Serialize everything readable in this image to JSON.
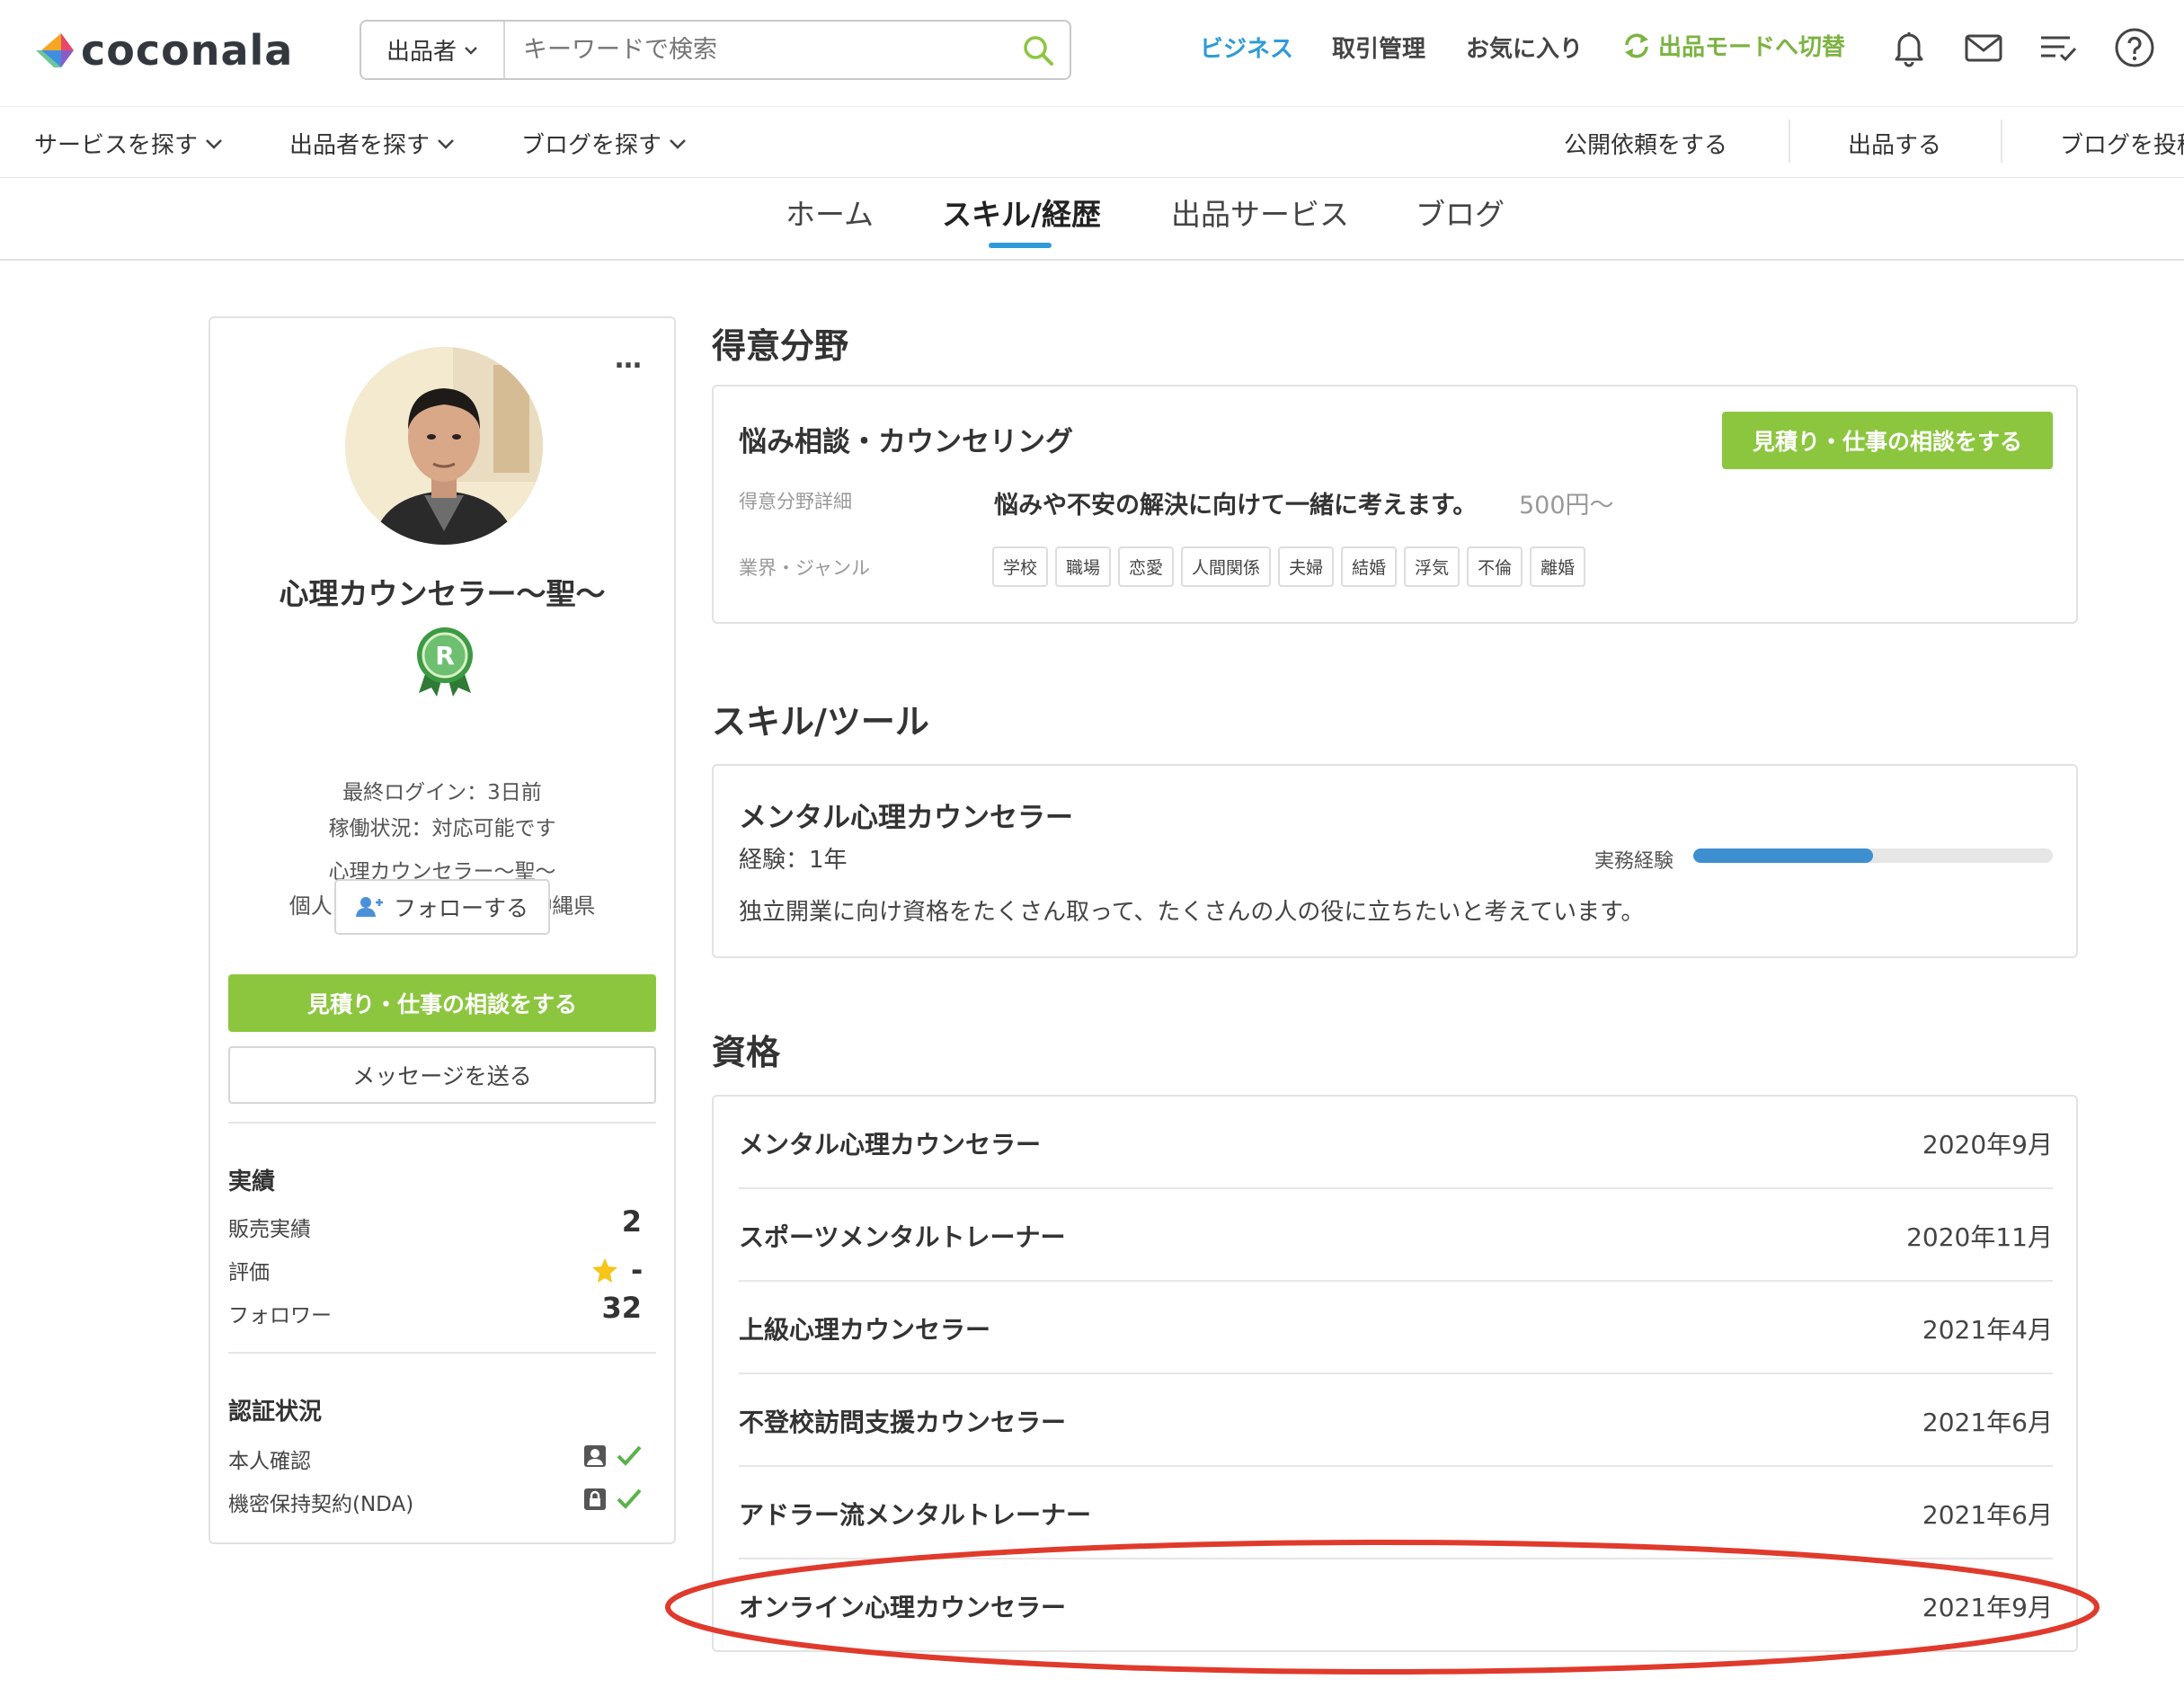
{
  "header": {
    "logo_text": "coconala",
    "search": {
      "scope": "出品者",
      "placeholder": "キーワードで検索"
    },
    "nav": {
      "business": "ビジネス",
      "transactions": "取引管理",
      "favorites": "お気に入り",
      "mode_switch": "出品モードへ切替"
    }
  },
  "subnav": {
    "find_services": "サービスを探す",
    "find_sellers": "出品者を探す",
    "find_blogs": "ブログを探す",
    "public_request": "公開依頼をする",
    "sell": "出品する",
    "post_blog": "ブログを投稿"
  },
  "tabs": [
    "ホーム",
    "スキル/経歴",
    "出品サービス",
    "ブログ"
  ],
  "profile": {
    "more": "…",
    "name": "心理カウンセラー〜聖〜",
    "rank": "R",
    "last_login": "最終ログイン：3日前",
    "availability": "稼働状況：対応可能です",
    "display_name": "心理カウンセラー〜聖〜",
    "attributes": "個人 /  30代後半 /  男性 /  沖縄県",
    "follow": "フォローする",
    "consult": "見積り・仕事の相談をする",
    "message": "メッセージを送る",
    "results": {
      "title": "実績",
      "sales_label": "販売実績",
      "sales_value": "2",
      "rating_label": "評価",
      "rating_value": "-",
      "followers_label": "フォロワー",
      "followers_value": "32"
    },
    "verification": {
      "title": "認証状況",
      "identity": "本人確認",
      "nda": "機密保持契約(NDA)"
    }
  },
  "specialty": {
    "section_title": "得意分野",
    "name": "悩み相談・カウンセリング",
    "consult": "見積り・仕事の相談をする",
    "detail_label": "得意分野詳細",
    "detail_text": "悩みや不安の解決に向けて一緒に考えます。",
    "price": "500円〜",
    "genre_label": "業界・ジャンル",
    "tags": [
      "学校",
      "職場",
      "恋愛",
      "人間関係",
      "夫婦",
      "結婚",
      "浮気",
      "不倫",
      "離婚"
    ]
  },
  "skills": {
    "section_title": "スキル/ツール",
    "name": "メンタル心理カウンセラー",
    "experience": "経験：1年",
    "practical_label": "実務経験",
    "practical_level": 0.5,
    "description": "独立開業に向け資格をたくさん取って、たくさんの人の役に立ちたいと考えています。"
  },
  "qualifications": {
    "section_title": "資格",
    "items": [
      {
        "name": "メンタル心理カウンセラー",
        "date": "2020年9月"
      },
      {
        "name": "スポーツメンタルトレーナー",
        "date": "2020年11月"
      },
      {
        "name": "上級心理カウンセラー",
        "date": "2021年4月"
      },
      {
        "name": "不登校訪問支援カウンセラー",
        "date": "2021年6月"
      },
      {
        "name": "アドラー流メンタルトレーナー",
        "date": "2021年6月"
      },
      {
        "name": "オンライン心理カウンセラー",
        "date": "2021年9月"
      }
    ]
  },
  "colors": {
    "brand_green": "#8cc63f",
    "link_blue": "#2e9bd6",
    "highlight_red": "#e03a2c"
  }
}
